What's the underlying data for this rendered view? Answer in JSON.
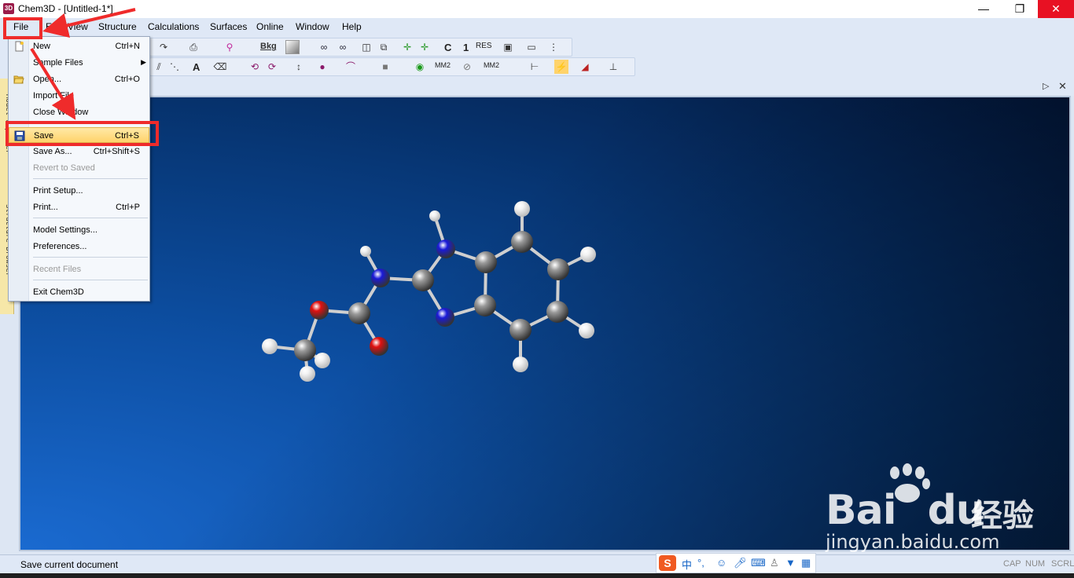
{
  "window": {
    "title": "Chem3D - [Untitled-1*]",
    "app_icon_text": "3D",
    "min_glyph": "—",
    "max_glyph": "❐",
    "close_glyph": "✕"
  },
  "menubar": {
    "items": [
      "File",
      "Edit",
      "View",
      "Structure",
      "Calculations",
      "Surfaces",
      "Online",
      "Window",
      "Help"
    ]
  },
  "toolbar": {
    "bkg_label": "Bkg",
    "c_label": "C",
    "one_label": "1",
    "res_label": "RES",
    "mm2_label": "MM2",
    "a_label": "A"
  },
  "file_menu": {
    "items": [
      {
        "label": "New",
        "shortcut": "Ctrl+N",
        "icon": "new-document-icon"
      },
      {
        "label": "Sample Files",
        "shortcut": "",
        "submenu": true
      },
      {
        "label": "Open...",
        "shortcut": "Ctrl+O",
        "icon": "open-folder-icon"
      },
      {
        "label": "Import File",
        "shortcut": ""
      },
      {
        "label": "Close Window",
        "shortcut": ""
      },
      {
        "label": "Save",
        "shortcut": "Ctrl+S",
        "icon": "save-disk-icon",
        "highlighted": true
      },
      {
        "label": "Save As...",
        "shortcut": "Ctrl+Shift+S"
      },
      {
        "label": "Revert to Saved",
        "shortcut": "",
        "disabled": true
      },
      {
        "label": "Print Setup...",
        "shortcut": ""
      },
      {
        "label": "Print...",
        "shortcut": "Ctrl+P"
      },
      {
        "label": "Model Settings...",
        "shortcut": ""
      },
      {
        "label": "Preferences...",
        "shortcut": ""
      },
      {
        "label": "Recent Files",
        "shortcut": "",
        "disabled": true
      },
      {
        "label": "Exit Chem3D",
        "shortcut": ""
      }
    ]
  },
  "left_dock": {
    "tab1": "Model Explorer",
    "tab2": "Structure Browser"
  },
  "statusbar": {
    "text": "Save current document",
    "indicators": [
      "CAP",
      "NUM",
      "SCRL"
    ]
  },
  "ime": {
    "logo": "S",
    "mode": "中",
    "punct": "°,"
  },
  "watermark": {
    "brand": "Bai",
    "brand2": "du",
    "chinese": "经验",
    "url": "jingyan.baidu.com"
  },
  "colors": {
    "carbon": "#9a9a9a",
    "nitrogen": "#1a1ad8",
    "oxygen": "#e01010",
    "hydrogen": "#f2f2f2",
    "annotation_red": "#ef2b2b",
    "menu_highlight": "#ffd36b"
  }
}
